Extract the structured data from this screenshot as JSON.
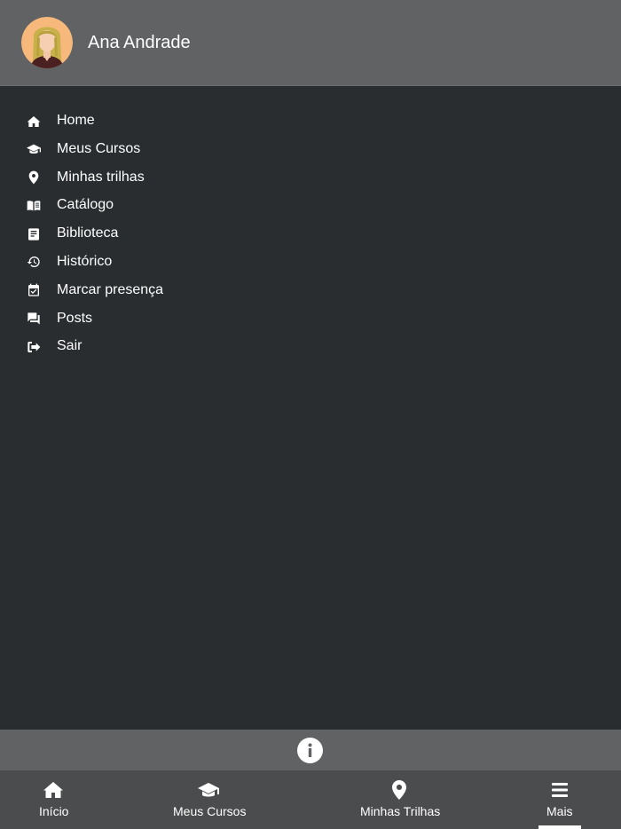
{
  "user": {
    "name": "Ana Andrade"
  },
  "menu": {
    "items": [
      {
        "label": "Home",
        "icon": "home-icon"
      },
      {
        "label": "Meus Cursos",
        "icon": "graduation-cap-icon"
      },
      {
        "label": "Minhas trilhas",
        "icon": "map-pin-icon"
      },
      {
        "label": "Catálogo",
        "icon": "open-book-icon"
      },
      {
        "label": "Biblioteca",
        "icon": "book-icon"
      },
      {
        "label": "Histórico",
        "icon": "history-icon"
      },
      {
        "label": "Marcar presença",
        "icon": "calendar-check-icon"
      },
      {
        "label": "Posts",
        "icon": "forum-icon"
      },
      {
        "label": "Sair",
        "icon": "sign-out-icon"
      }
    ]
  },
  "info": {
    "icon": "info-icon"
  },
  "tabs": [
    {
      "label": "Início",
      "icon": "home-icon",
      "active": false
    },
    {
      "label": "Meus Cursos",
      "icon": "graduation-cap-icon",
      "active": false
    },
    {
      "label": "Minhas Trilhas",
      "icon": "map-pin-icon",
      "active": false
    },
    {
      "label": "Mais",
      "icon": "menu-icon",
      "active": true
    }
  ],
  "colors": {
    "header_bg": "#616264",
    "drawer_bg": "#292d30",
    "tabbar_bg": "#4b4c4e",
    "text": "#ffffff",
    "avatar_bg": "#f7b97b"
  }
}
